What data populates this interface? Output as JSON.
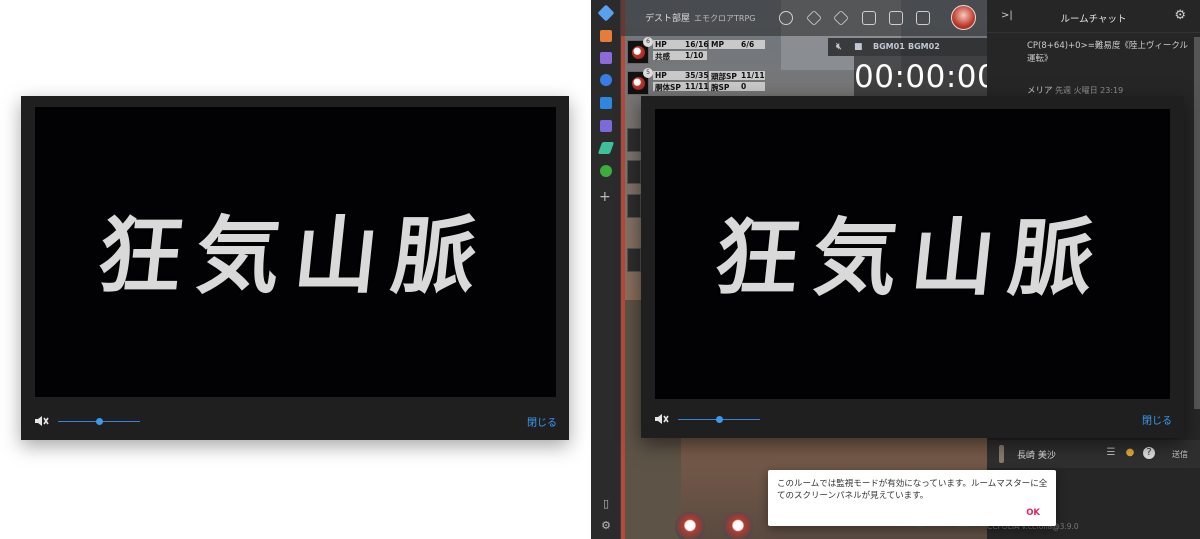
{
  "left_player": {
    "title_art": "狂気山脈",
    "close_label": "閉じる",
    "volume_level": 0.5
  },
  "app": {
    "room_name": "デスト部屋",
    "room_subtitle": "エモクロアTRPG",
    "chat": {
      "title": "ルームチャット",
      "messages": [
        {
          "name": "",
          "text": "CP(8+64)+0>=難易度《陸上ヴィークル運転》"
        },
        {
          "name": "メリア",
          "time": "先週 火曜日 23:19",
          "text": ""
        }
      ],
      "input_character": "長崎 美沙",
      "send_label": "送信"
    },
    "characters": [
      {
        "level": "6",
        "rows": [
          [
            "HP",
            "16/16",
            "MP",
            "6/6"
          ],
          [
            "共感",
            "1/10",
            "",
            ""
          ]
        ]
      },
      {
        "level": "5",
        "rows": [
          [
            "HP",
            "35/35",
            "頭部SP",
            "11/11"
          ],
          [
            "胴体SP",
            "11/11",
            "腕SP",
            "0"
          ]
        ]
      }
    ],
    "bgm": [
      "BGM01",
      "BGM02"
    ],
    "timer": "00:00:00",
    "player": {
      "title_art": "狂気山脈",
      "close_label": "閉じる",
      "volume_level": 0.5
    },
    "dialog": {
      "text": "このルームでは監視モードが有効になっています。ルームマスターに全てのスクリーンパネルが見えています。",
      "ok_label": "OK"
    },
    "version": "CCFOLIA v.ccfolia@3.9.0",
    "colors": {
      "accent": "#3b9bf5",
      "dialog_ok": "#e0245e",
      "sidebar_bg": "#2b2b2b"
    }
  }
}
